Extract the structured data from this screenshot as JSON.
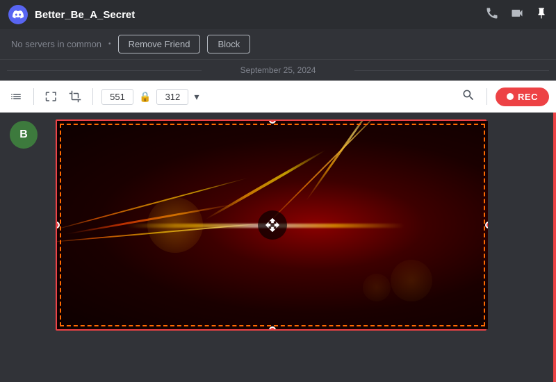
{
  "titleBar": {
    "username": "Better_Be_A_Secret",
    "logoText": "D"
  },
  "friendBar": {
    "noServersText": "No servers in common",
    "removeFriendLabel": "Remove Friend",
    "blockLabel": "Block"
  },
  "dateSeparator": {
    "date": "September 25, 2024"
  },
  "toolbar": {
    "widthValue": "551",
    "heightValue": "312",
    "recLabel": "REC"
  },
  "icons": {
    "phone": "📞",
    "video": "📹",
    "pin": "📌",
    "search": "🔍",
    "rec_dot": "●"
  }
}
